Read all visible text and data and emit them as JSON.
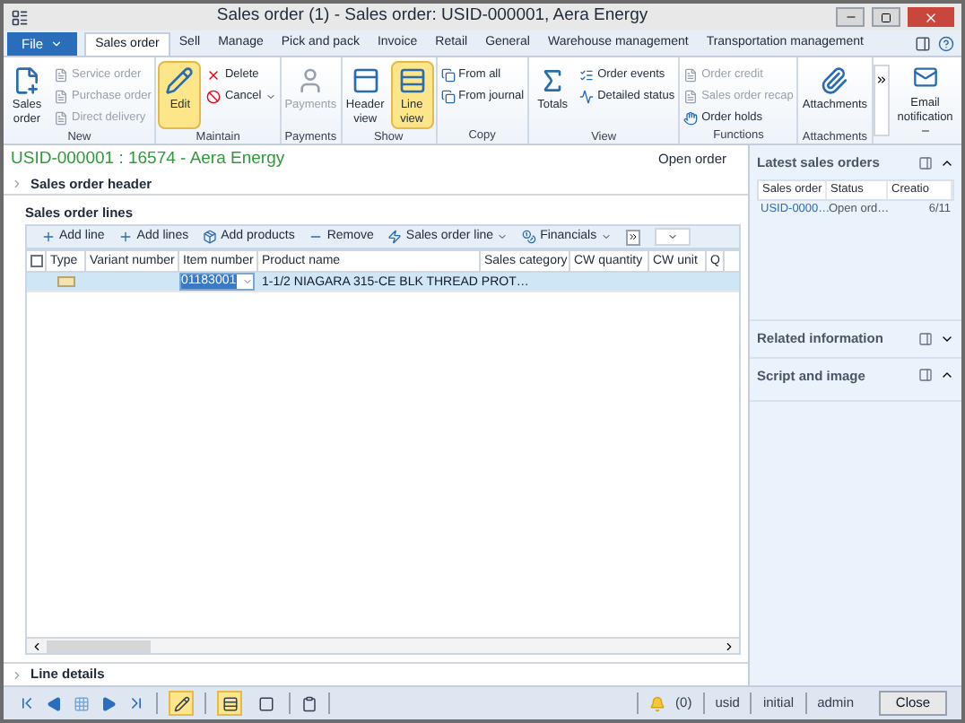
{
  "window": {
    "title": "Sales order (1) - Sales order: USID-000001, Aera Energy"
  },
  "menu_tabs": [
    {
      "label": "File",
      "kind": "file",
      "selected": false
    },
    {
      "label": "Sales order",
      "kind": "tab",
      "selected": true
    },
    {
      "label": "Sell",
      "kind": "tab",
      "selected": false
    },
    {
      "label": "Manage",
      "kind": "tab",
      "selected": false
    },
    {
      "label": "Pick and pack",
      "kind": "tab",
      "selected": false
    },
    {
      "label": "Invoice",
      "kind": "tab",
      "selected": false
    },
    {
      "label": "Retail",
      "kind": "tab",
      "selected": false
    },
    {
      "label": "General",
      "kind": "tab",
      "selected": false
    },
    {
      "label": "Warehouse management",
      "kind": "tab",
      "selected": false
    },
    {
      "label": "Transportation management",
      "kind": "tab",
      "selected": false
    }
  ],
  "ribbon_groups": [
    {
      "label": "New",
      "buttons": [
        {
          "label": "Sales order",
          "kind": "large",
          "disabled": false,
          "selected": false
        },
        {
          "label": "Service order",
          "kind": "small",
          "disabled": true,
          "selected": false
        },
        {
          "label": "Purchase order",
          "kind": "small",
          "disabled": true,
          "selected": false
        },
        {
          "label": "Direct delivery",
          "kind": "small",
          "disabled": true,
          "selected": false
        }
      ]
    },
    {
      "label": "Maintain",
      "buttons": [
        {
          "label": "Edit",
          "kind": "large",
          "disabled": false,
          "selected": true
        },
        {
          "label": "Delete",
          "kind": "small",
          "disabled": false,
          "selected": false
        },
        {
          "label": "Cancel",
          "kind": "small",
          "disabled": false,
          "selected": false,
          "menu": true
        }
      ]
    },
    {
      "label": "Payments",
      "buttons": [
        {
          "label": "Payments",
          "kind": "large",
          "disabled": true,
          "selected": false
        }
      ]
    },
    {
      "label": "Show",
      "buttons": [
        {
          "label": "Header view",
          "kind": "large",
          "disabled": false,
          "selected": false
        },
        {
          "label": "Line view",
          "kind": "large",
          "disabled": false,
          "selected": true
        }
      ]
    },
    {
      "label": "Copy",
      "buttons": [
        {
          "label": "From all",
          "kind": "small",
          "disabled": false,
          "selected": false
        },
        {
          "label": "From journal",
          "kind": "small",
          "disabled": false,
          "selected": false
        }
      ]
    },
    {
      "label": "View",
      "buttons": [
        {
          "label": "Totals",
          "kind": "large",
          "disabled": false,
          "selected": false
        },
        {
          "label": "Order events",
          "kind": "small",
          "disabled": false,
          "selected": false
        },
        {
          "label": "Detailed status",
          "kind": "small",
          "disabled": false,
          "selected": false
        }
      ]
    },
    {
      "label": "Functions",
      "buttons": [
        {
          "label": "Order credit",
          "kind": "small",
          "disabled": true,
          "selected": false
        },
        {
          "label": "Sales order recap",
          "kind": "small",
          "disabled": true,
          "selected": false
        },
        {
          "label": "Order holds",
          "kind": "small",
          "disabled": false,
          "selected": false
        }
      ]
    },
    {
      "label": "Attachments",
      "buttons": [
        {
          "label": "Attachments",
          "kind": "large",
          "disabled": false,
          "selected": false
        }
      ]
    }
  ],
  "email_button": {
    "label": "Email notification"
  },
  "order_title": "USID-000001 : 16574 - Aera Energy",
  "order_status": "Open order",
  "header_section": {
    "label": "Sales order header",
    "expanded": false
  },
  "lines_section": {
    "label": "Sales order lines",
    "expanded": true
  },
  "lines_toolbar": [
    {
      "label": "Add line",
      "menu": false
    },
    {
      "label": "Add lines",
      "menu": false
    },
    {
      "label": "Add products",
      "menu": false
    },
    {
      "label": "Remove",
      "menu": false
    },
    {
      "label": "Sales order line",
      "menu": true
    },
    {
      "label": "Financials",
      "menu": true
    }
  ],
  "select_all": {
    "checked": false
  },
  "columns": [
    "Type",
    "Variant number",
    "Item number",
    "Product name",
    "Sales category",
    "CW quantity",
    "CW unit",
    "Q"
  ],
  "rows": [
    {
      "selected": true,
      "item_number": "01183001",
      "product_name": "1-1/2 NIAGARA 315-CE BLK THREAD PROT…"
    }
  ],
  "line_details": {
    "label": "Line details",
    "expanded": false
  },
  "latest_orders": {
    "title": "Latest sales orders",
    "expanded": true,
    "columns": [
      "Sales order",
      "Status",
      "Creatio"
    ],
    "rows": [
      [
        "USID-0000…",
        "Open ord…",
        "6/11"
      ]
    ]
  },
  "related_info": {
    "title": "Related information",
    "expanded": false
  },
  "script_image": {
    "title": "Script and image",
    "expanded": true
  },
  "status_bar": {
    "edit_mode": true,
    "grid_view": true,
    "alerts": "(0)",
    "fields": [
      "usid",
      "initial",
      "admin"
    ],
    "close": "Close"
  }
}
